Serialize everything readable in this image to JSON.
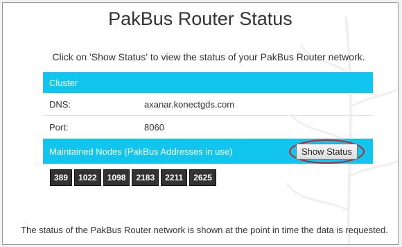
{
  "title": "PakBus Router Status",
  "intro": "Click on 'Show Status' to view the status of your PakBus Router network.",
  "cluster": {
    "header": "Cluster",
    "dns_label": "DNS:",
    "dns_value": "axanar.konectgds.com",
    "port_label": "Port:",
    "port_value": "8060",
    "nodes_header": "Maintained Nodes (PakBus Addresses in use)",
    "show_status_label": "Show Status",
    "nodes": [
      "389",
      "1022",
      "1098",
      "2183",
      "2211",
      "2625"
    ]
  },
  "footnote": "The status of the PakBus Router network is shown at the point in time the data is requested.",
  "colors": {
    "header_bg": "#11c5ef",
    "highlight_ring": "#d0191b",
    "node_bg": "#333333"
  }
}
